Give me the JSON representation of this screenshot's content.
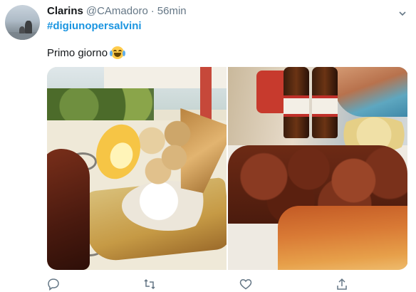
{
  "tweet": {
    "author_name": "Clarins",
    "author_handle": "@CAmadoro",
    "separator": "·",
    "timestamp": "56min",
    "hashtag": "#digiunopersalvini",
    "text": "Primo giorno",
    "emoji": "face-with-tears-of-joy"
  },
  "media": {
    "photos": [
      "fried-seafood-plate",
      "octopus-stew-plate"
    ]
  },
  "actions": {
    "icons": [
      "reply-icon",
      "retweet-icon",
      "like-icon",
      "share-icon"
    ]
  },
  "colors": {
    "link": "#1b95e0",
    "secondary_text": "#657786",
    "primary_text": "#14171a"
  }
}
